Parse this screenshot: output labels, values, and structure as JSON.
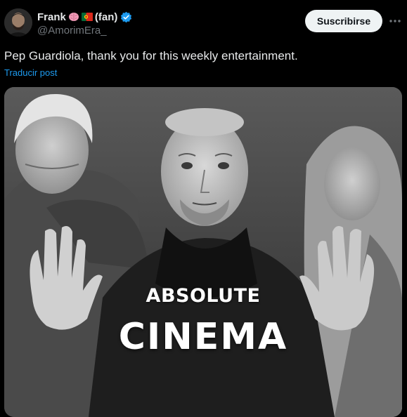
{
  "post": {
    "author": {
      "display_name": "Frank",
      "emojis": [
        "brain-emoji",
        "portugal-flag-emoji"
      ],
      "suffix": "(fan)",
      "handle": "@AmorimEra_",
      "verified": true
    },
    "subscribe_label": "Suscribirse",
    "more_icon": "more-dots-icon",
    "text": "Pep Guardiola, thank you for this weekly entertainment.",
    "translate_label": "Traducir post",
    "media": {
      "caption_top": "ABSOLUTE",
      "caption_bottom": "CINEMA"
    }
  },
  "colors": {
    "background": "#000000",
    "text_primary": "#e7e9ea",
    "text_secondary": "#71767b",
    "link": "#1d9bf0",
    "verified": "#1d9bf0",
    "button_bg": "#eff3f4",
    "button_text": "#0f1419"
  }
}
